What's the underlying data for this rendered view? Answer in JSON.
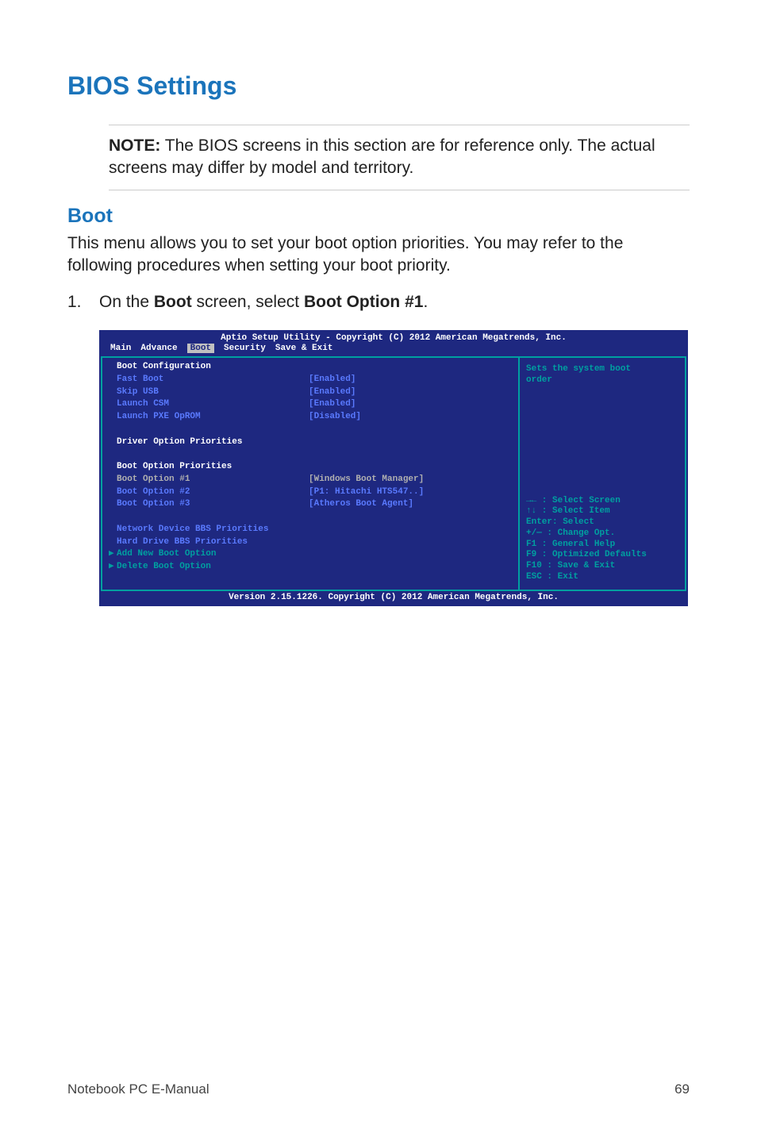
{
  "page": {
    "title": "BIOS Settings",
    "note_label": "NOTE:",
    "note_text": " The BIOS screens in this section are for reference only. The actual screens may differ by model and territory.",
    "section": "Boot",
    "intro": "This menu allows you to set your boot option priorities. You may refer to the following procedures when setting your boot priority.",
    "step_num": "1.",
    "step_pre": "On the ",
    "step_b1": "Boot",
    "step_mid": " screen, select ",
    "step_b2": "Boot Option #1",
    "step_post": "."
  },
  "bios": {
    "topbar": "Aptio Setup Utility - Copyright (C) 2012 American Megatrends, Inc.",
    "tabs": {
      "main": "Main",
      "advance": "Advance",
      "boot": "Boot",
      "security": "Security",
      "save": "Save & Exit"
    },
    "left": {
      "heading1": "Boot Configuration",
      "rows1": [
        {
          "l": "Fast Boot",
          "v": "[Enabled]"
        },
        {
          "l": "Skip USB",
          "v": "[Enabled]"
        },
        {
          "l": "Launch CSM",
          "v": "[Enabled]"
        },
        {
          "l": "Launch PXE OpROM",
          "v": "[Disabled]"
        }
      ],
      "heading2": "Driver Option Priorities",
      "heading3": "Boot Option Priorities",
      "rows2": [
        {
          "l": "Boot Option #1",
          "v": "[Windows Boot Manager]",
          "sel": true
        },
        {
          "l": "Boot Option #2",
          "v": "[P1: Hitachi HTS547..]",
          "sel": false
        },
        {
          "l": "Boot Option #3",
          "v": "[Atheros Boot Agent]",
          "sel": false
        }
      ],
      "rows3": [
        "Network Device BBS Priorities",
        "Hard Drive BBS Priorities"
      ],
      "arrows": [
        "Add New Boot Option",
        "Delete Boot Option"
      ]
    },
    "right": {
      "help1a": "Sets the system boot",
      "help1b": "order",
      "keys": [
        "→←  : Select Screen",
        "↑↓   : Select Item",
        "Enter: Select",
        "+/—  : Change Opt.",
        "F1   : General Help",
        "F9   : Optimized Defaults",
        "F10  : Save & Exit",
        "ESC  : Exit"
      ]
    },
    "footer": "Version 2.15.1226. Copyright (C) 2012 American Megatrends, Inc."
  },
  "footer": {
    "left": "Notebook PC E-Manual",
    "right": "69"
  }
}
